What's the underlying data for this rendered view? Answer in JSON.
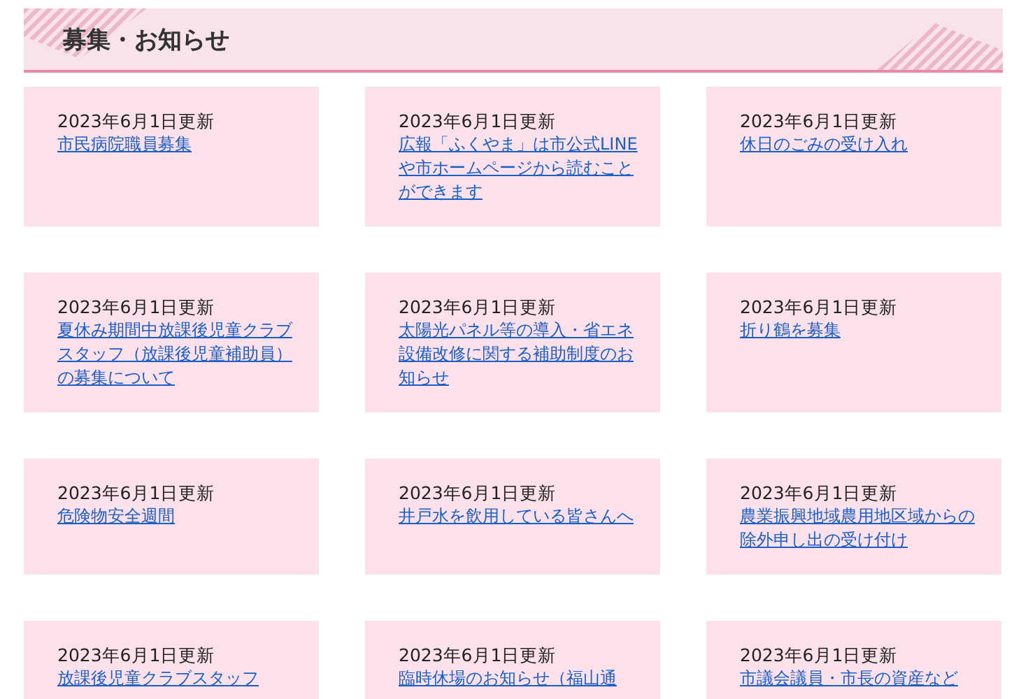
{
  "section": {
    "title": "募集・お知らせ"
  },
  "notices": [
    {
      "date": "2023年6月1日更新",
      "title": "市民病院職員募集"
    },
    {
      "date": "2023年6月1日更新",
      "title": "広報「ふくやま」は市公式LINEや市ホームページから読むことができます"
    },
    {
      "date": "2023年6月1日更新",
      "title": "休日のごみの受け入れ"
    },
    {
      "date": "2023年6月1日更新",
      "title": "夏休み期間中放課後児童クラブスタッフ（放課後児童補助員）の募集について"
    },
    {
      "date": "2023年6月1日更新",
      "title": "太陽光パネル等の導入・省エネ設備改修に関する補助制度のお知らせ"
    },
    {
      "date": "2023年6月1日更新",
      "title": "折り鶴を募集"
    },
    {
      "date": "2023年6月1日更新",
      "title": "危険物安全週間"
    },
    {
      "date": "2023年6月1日更新",
      "title": "井戸水を飲用している皆さんへ"
    },
    {
      "date": "2023年6月1日更新",
      "title": "農業振興地域農用地区域からの除外申し出の受け付け"
    },
    {
      "date": "2023年6月1日更新",
      "title": "放課後児童クラブスタッフ"
    },
    {
      "date": "2023年6月1日更新",
      "title": "臨時休場のお知らせ（福山通"
    },
    {
      "date": "2023年6月1日更新",
      "title": "市議会議員・市長の資産など"
    }
  ]
}
